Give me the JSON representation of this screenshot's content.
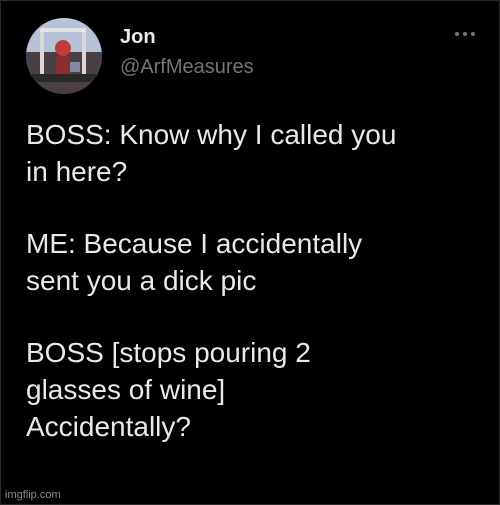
{
  "author": {
    "name": "Jon",
    "handle": "@ArfMeasures"
  },
  "menu": {
    "icon": "more-horizontal-icon"
  },
  "tweet": {
    "paragraphs": [
      "BOSS: Know why I called you\nin here?",
      "ME: Because I accidentally\nsent you a dick pic",
      "BOSS [stops pouring 2\nglasses of wine]\nAccidentally?"
    ]
  },
  "watermark": "imgflip.com",
  "colors": {
    "background": "#000000",
    "text": "#e7e9ea",
    "muted": "#71767b"
  }
}
